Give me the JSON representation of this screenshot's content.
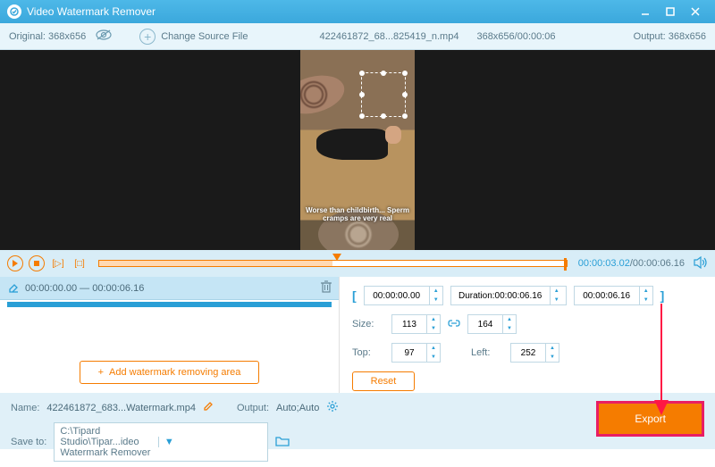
{
  "titlebar": {
    "title": "Video Watermark Remover"
  },
  "toolbar": {
    "original": "Original: 368x656",
    "change_source": "Change Source File",
    "filename": "422461872_68...825419_n.mp4",
    "dimensions": "368x656/00:00:06",
    "output": "Output: 368x656"
  },
  "preview": {
    "caption": "Worse than childbirth... Sperm cramps are very real"
  },
  "playback": {
    "current": "00:00:03.02",
    "duration": "/00:00:06.16"
  },
  "segment": {
    "range": "00:00:00.00 — 00:00:06.16"
  },
  "add_area": "Add watermark removing area",
  "timing": {
    "start": "00:00:00.00",
    "duration_label": "Duration:",
    "duration": "00:00:06.16",
    "end": "00:00:06.16"
  },
  "size": {
    "label": "Size:",
    "width": "113",
    "height": "164"
  },
  "position": {
    "top_label": "Top:",
    "top": "97",
    "left_label": "Left:",
    "left": "252"
  },
  "reset": "Reset",
  "bottom": {
    "name_label": "Name:",
    "name": "422461872_683...Watermark.mp4",
    "output_label": "Output:",
    "output": "Auto;Auto",
    "save_label": "Save to:",
    "save_path": "C:\\Tipard Studio\\Tipar...ideo Watermark Remover"
  },
  "export": "Export"
}
